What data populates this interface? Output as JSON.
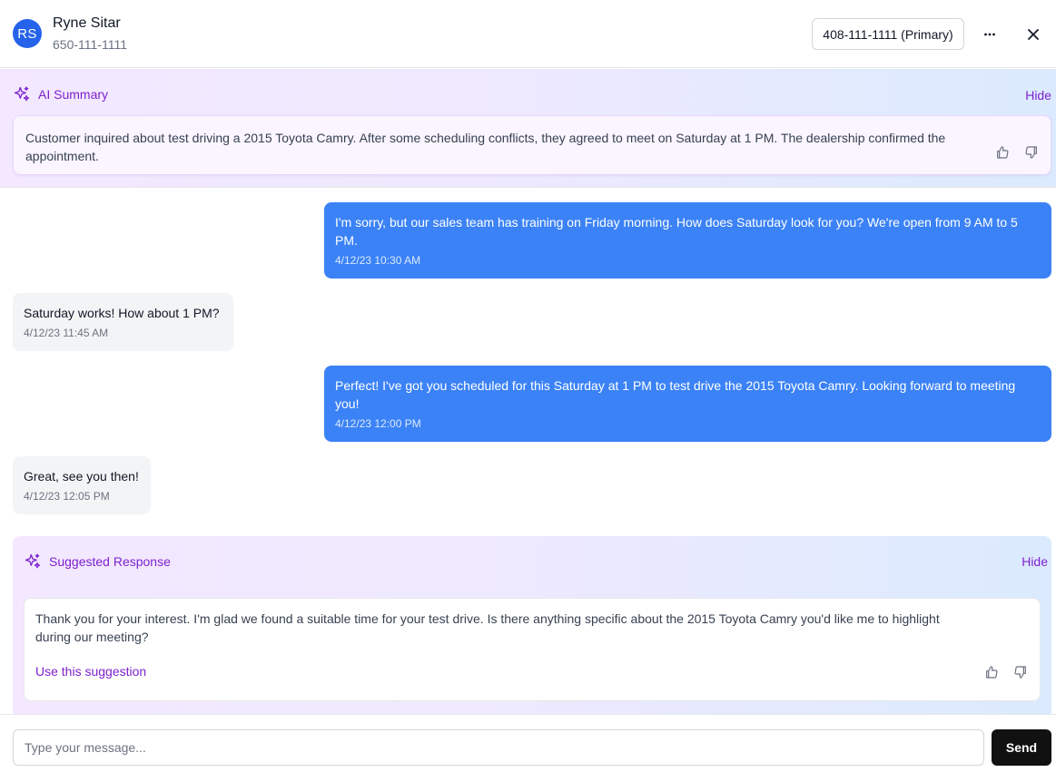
{
  "contact": {
    "initials": "RS",
    "name": "Ryne Sitar",
    "phone": "650-111-1111",
    "primary_phone_label": "408-111-1111 (Primary)"
  },
  "header": {
    "more_icon": "ellipsis-horizontal-icon",
    "close_icon": "close-icon"
  },
  "ai_summary": {
    "title": "AI Summary",
    "icon": "sparkles-icon",
    "hide_label": "Hide",
    "text": "Customer inquired about test driving a 2015 Toyota Camry. After some scheduling conflicts, they agreed to meet on Saturday at 1 PM. The dealership confirmed the appointment."
  },
  "messages": [
    {
      "direction": "outgoing",
      "text": "I'm sorry, but our sales team has training on Friday morning. How does Saturday look for you? We're open from 9 AM to 5 PM.",
      "time": "4/12/23 10:30 AM"
    },
    {
      "direction": "incoming",
      "text": "Saturday works! How about 1 PM?",
      "time": "4/12/23 11:45 AM"
    },
    {
      "direction": "outgoing",
      "text": "Perfect! I've got you scheduled for this Saturday at 1 PM to test drive the 2015 Toyota Camry. Looking forward to meeting you!",
      "time": "4/12/23 12:00 PM"
    },
    {
      "direction": "incoming",
      "text": "Great, see you then!",
      "time": "4/12/23 12:05 PM"
    }
  ],
  "suggested_response": {
    "title": "Suggested Response",
    "icon": "sparkles-icon",
    "hide_label": "Hide",
    "text": "Thank you for your interest. I'm glad we found a suitable time for your test drive. Is there anything specific about the 2015 Toyota Camry you'd like me to highlight during our meeting?",
    "use_label": "Use this suggestion"
  },
  "composer": {
    "placeholder": "Type your message...",
    "send_label": "Send"
  },
  "colors": {
    "accent_purple": "#7e22ce",
    "outgoing_bubble": "#3b82f6",
    "incoming_bubble": "#f3f4f6",
    "avatar": "#2563eb",
    "send_button": "#111111"
  }
}
